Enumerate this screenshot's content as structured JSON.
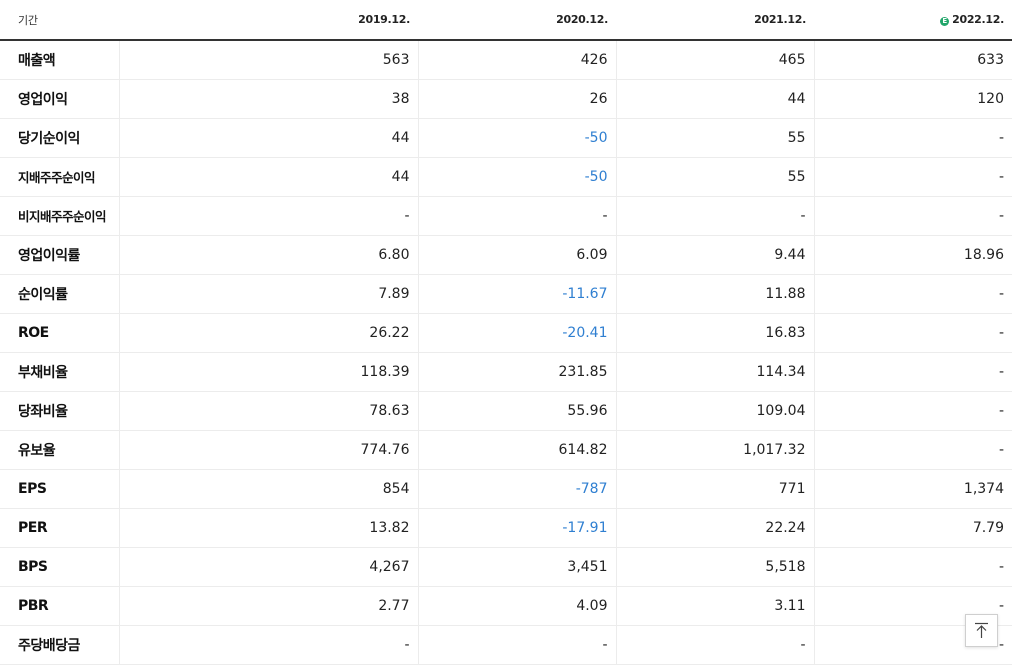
{
  "header": {
    "period_label": "기간",
    "periods": [
      "2019.12.",
      "2020.12.",
      "2021.12.",
      "2022.12."
    ],
    "estimate_mark": "E"
  },
  "rows": [
    {
      "label": "매출액",
      "values": [
        "563",
        "426",
        "465",
        "633"
      ],
      "neg": [
        false,
        false,
        false,
        false
      ]
    },
    {
      "label": "영업이익",
      "values": [
        "38",
        "26",
        "44",
        "120"
      ],
      "neg": [
        false,
        false,
        false,
        false
      ]
    },
    {
      "label": "당기순이익",
      "values": [
        "44",
        "-50",
        "55",
        "-"
      ],
      "neg": [
        false,
        true,
        false,
        false
      ]
    },
    {
      "label": "지배주주순이익",
      "values": [
        "44",
        "-50",
        "55",
        "-"
      ],
      "neg": [
        false,
        true,
        false,
        false
      ]
    },
    {
      "label": "비지배주주순이익",
      "values": [
        "-",
        "-",
        "-",
        "-"
      ],
      "neg": [
        false,
        false,
        false,
        false
      ]
    },
    {
      "label": "영업이익률",
      "values": [
        "6.80",
        "6.09",
        "9.44",
        "18.96"
      ],
      "neg": [
        false,
        false,
        false,
        false
      ]
    },
    {
      "label": "순이익률",
      "values": [
        "7.89",
        "-11.67",
        "11.88",
        "-"
      ],
      "neg": [
        false,
        true,
        false,
        false
      ]
    },
    {
      "label": "ROE",
      "values": [
        "26.22",
        "-20.41",
        "16.83",
        "-"
      ],
      "neg": [
        false,
        true,
        false,
        false
      ]
    },
    {
      "label": "부채비율",
      "values": [
        "118.39",
        "231.85",
        "114.34",
        "-"
      ],
      "neg": [
        false,
        false,
        false,
        false
      ]
    },
    {
      "label": "당좌비율",
      "values": [
        "78.63",
        "55.96",
        "109.04",
        "-"
      ],
      "neg": [
        false,
        false,
        false,
        false
      ]
    },
    {
      "label": "유보율",
      "values": [
        "774.76",
        "614.82",
        "1,017.32",
        "-"
      ],
      "neg": [
        false,
        false,
        false,
        false
      ]
    },
    {
      "label": "EPS",
      "values": [
        "854",
        "-787",
        "771",
        "1,374"
      ],
      "neg": [
        false,
        true,
        false,
        false
      ]
    },
    {
      "label": "PER",
      "values": [
        "13.82",
        "-17.91",
        "22.24",
        "7.79"
      ],
      "neg": [
        false,
        true,
        false,
        false
      ]
    },
    {
      "label": "BPS",
      "values": [
        "4,267",
        "3,451",
        "5,518",
        "-"
      ],
      "neg": [
        false,
        false,
        false,
        false
      ]
    },
    {
      "label": "PBR",
      "values": [
        "2.77",
        "4.09",
        "3.11",
        "-"
      ],
      "neg": [
        false,
        false,
        false,
        false
      ]
    },
    {
      "label": "주당배당금",
      "values": [
        "-",
        "-",
        "-",
        "-"
      ],
      "neg": [
        false,
        false,
        false,
        false
      ]
    }
  ],
  "colors": {
    "negative": "#2f7fd1",
    "estimate_badge": "#22a66a"
  },
  "icons": {
    "scroll_top": "arrow-up-to-line-icon"
  }
}
